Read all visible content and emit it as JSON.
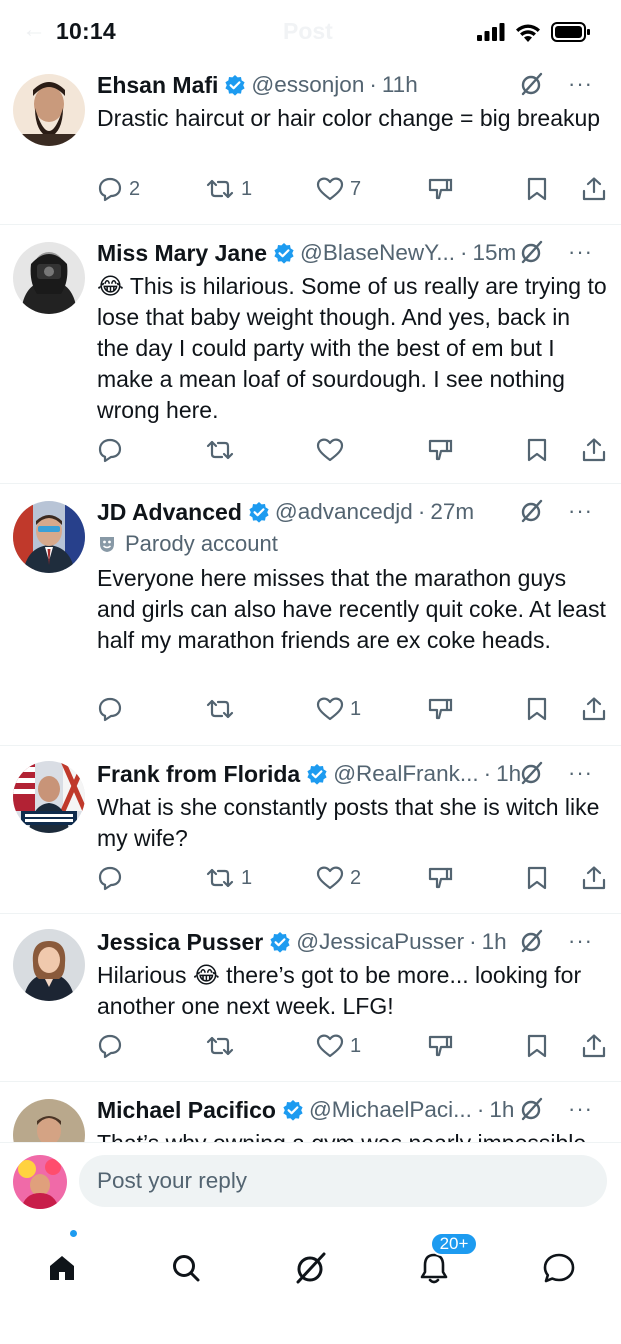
{
  "status_bar": {
    "time": "10:14",
    "ghost_title": "Post"
  },
  "tweets": [
    {
      "name": "Ehsan Mafi",
      "handle": "@essonjon",
      "time": "11h",
      "parody": "",
      "text": "Drastic haircut or hair color change = big breakup",
      "replies": "2",
      "reposts": "1",
      "likes": "7"
    },
    {
      "name": "Miss Mary Jane",
      "handle": "@BlaseNewY...",
      "time": "15m",
      "parody": "",
      "text": "😂 This is hilarious. Some of us really are trying to lose that baby weight though. And yes, back in the day I could party with the best of em but I make a mean loaf of sourdough. I see nothing wrong here.",
      "replies": "",
      "reposts": "",
      "likes": ""
    },
    {
      "name": "JD Advanced",
      "handle": "@advancedjd",
      "time": "27m",
      "parody": "Parody account",
      "text": "Everyone here misses that the marathon guys and girls can also have recently quit coke. At least half my marathon friends are ex coke heads.",
      "replies": "",
      "reposts": "",
      "likes": "1"
    },
    {
      "name": "Frank from Florida",
      "handle": "@RealFrank...",
      "time": "1h",
      "parody": "",
      "text": "What is she constantly posts that she is witch like my wife?",
      "replies": "",
      "reposts": "1",
      "likes": "2"
    },
    {
      "name": "Jessica Pusser",
      "handle": "@JessicaPusser",
      "time": "1h",
      "parody": "",
      "text": "Hilarious 😂 there’s got to be more... looking for another one next week. LFG!",
      "replies": "",
      "reposts": "",
      "likes": "1"
    },
    {
      "name": "Michael Pacifico",
      "handle": "@MichaelPaci...",
      "time": "1h",
      "parody": "",
      "text": "That’s why owning a gym was nearly impossible",
      "replies": "",
      "reposts": "",
      "likes": ""
    }
  ],
  "separator": "·",
  "reply": {
    "placeholder": "Post your reply"
  },
  "tabbar": {
    "notifications_badge": "20+"
  },
  "colors": {
    "accent": "#1d9bf0",
    "text": "#0f1419",
    "secondary": "#536471",
    "divider": "#eff3f4"
  },
  "icons": [
    "reply-icon",
    "repost-icon",
    "like-icon",
    "dislike-icon",
    "bookmark-icon",
    "share-icon",
    "grok-icon",
    "more-icon",
    "verified-icon",
    "home-icon",
    "search-icon",
    "notifications-icon",
    "messages-icon"
  ]
}
